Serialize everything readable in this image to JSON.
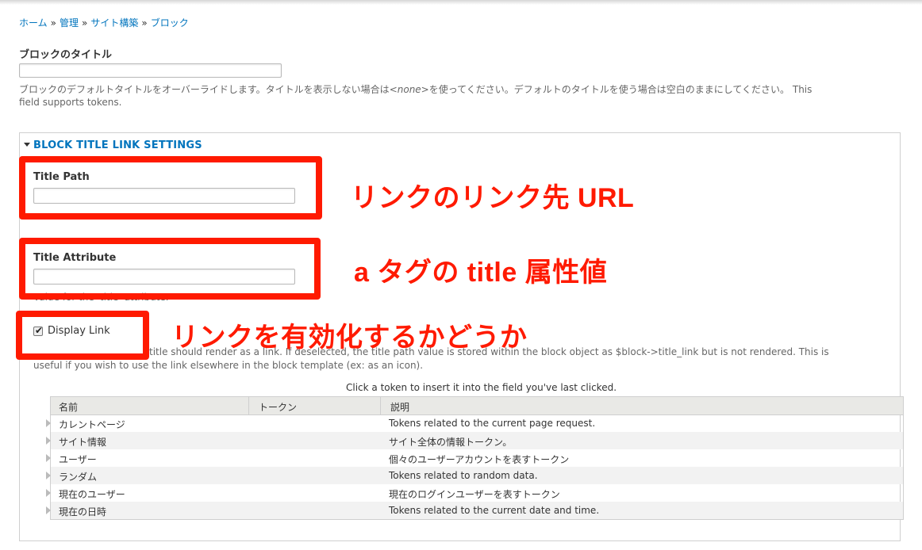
{
  "breadcrumb": [
    "ホーム",
    "管理",
    "サイト構築",
    "ブロック"
  ],
  "block_title": {
    "label": "ブロックのタイトル",
    "value": "",
    "description_before": "ブロックのデフォルトタイトルをオーバーライドします。タイトルを表示しない場合は",
    "description_none": "<none>",
    "description_after": "を使ってください。デフォルトのタイトルを使う場合は空白のままにしてください。 This",
    "description_line2": "field supports tokens."
  },
  "link_settings": {
    "legend": "BLOCK TITLE LINK SETTINGS",
    "title_path_label": "Title Path",
    "title_path_value": "",
    "title_attribute_label": "Title Attribute",
    "title_attribute_value": "",
    "title_attribute_desc_fragment": "Value for the 'title' attribute.",
    "display_link_label": "Display Link",
    "display_link_checked": true,
    "display_link_desc_visible": "title should render as a link. If deselected, the title path value is stored within the block object as $block->title_link but is not rendered. This is",
    "display_link_desc_line2": "useful if you wish to use the link elsewhere in the block template (ex: as an icon)."
  },
  "annotations": {
    "title_path": "リンクのリンク先 URL",
    "title_attribute": "a タグの title 属性値",
    "display_link": "リンクを有効化するかどうか",
    "color": "#ff1a00"
  },
  "tokens": {
    "caption": "Click a token to insert it into the field you've last clicked.",
    "headers": [
      "名前",
      "トークン",
      "説明"
    ],
    "rows": [
      {
        "name": "カレントページ",
        "token": "",
        "desc": "Tokens related to the current page request."
      },
      {
        "name": "サイト情報",
        "token": "",
        "desc": "サイト全体の情報トークン。"
      },
      {
        "name": "ユーザー",
        "token": "",
        "desc": "個々のユーザーアカウントを表すトークン"
      },
      {
        "name": "ランダム",
        "token": "",
        "desc": "Tokens related to random data."
      },
      {
        "name": "現在のユーザー",
        "token": "",
        "desc": "現在のログインユーザーを表すトークン"
      },
      {
        "name": "現在の日時",
        "token": "",
        "desc": "Tokens related to the current date and time."
      }
    ]
  },
  "colors": {
    "link": "#0074bd",
    "annotation": "#ff1a00"
  }
}
